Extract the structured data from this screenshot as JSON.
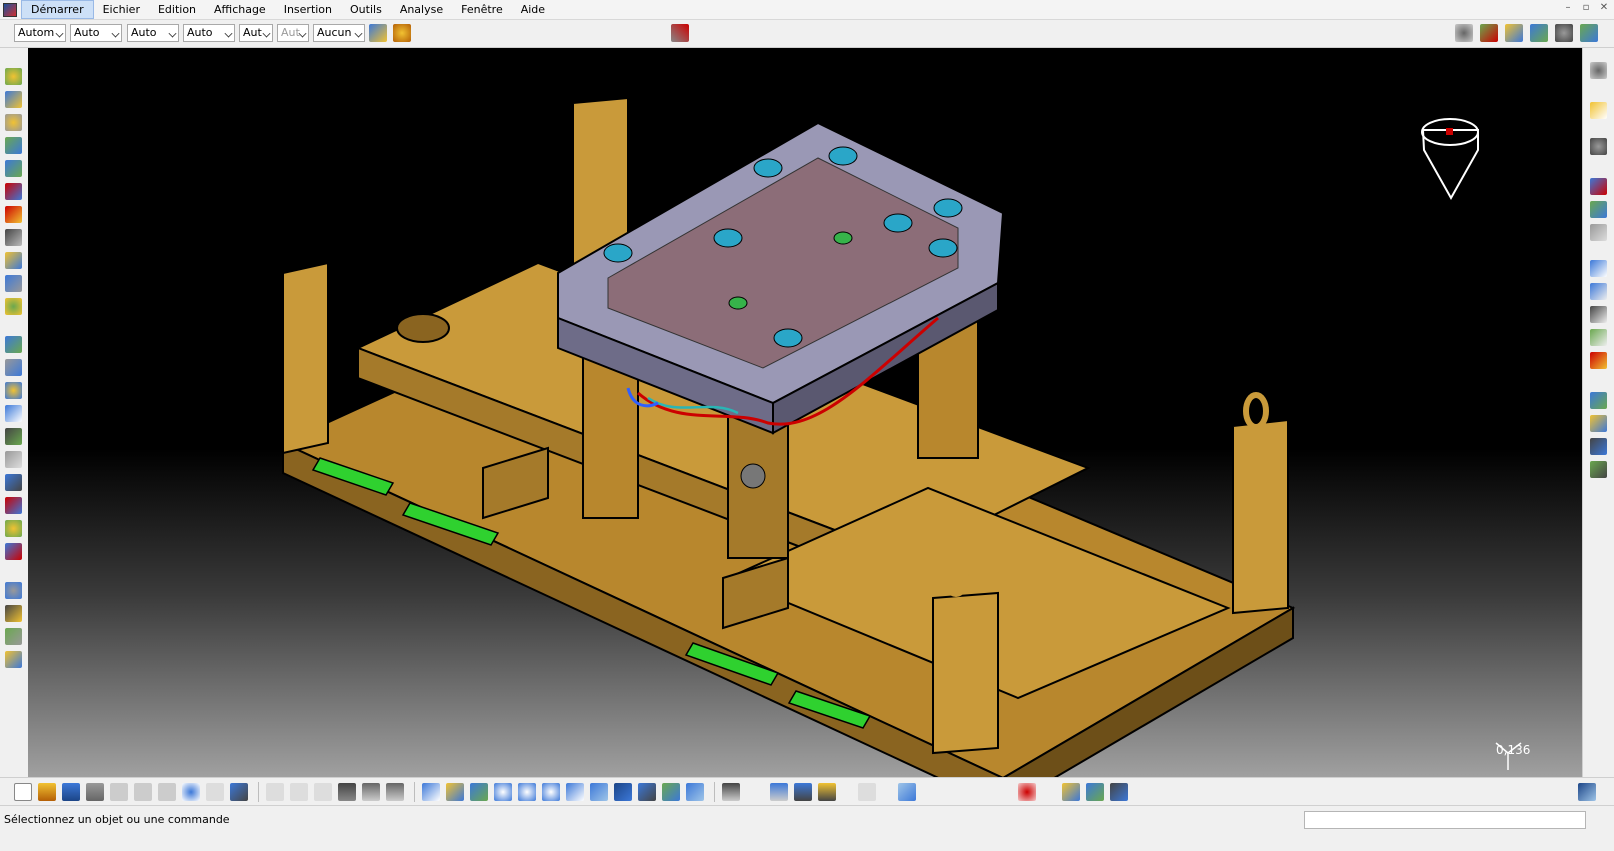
{
  "menubar": {
    "items": [
      {
        "label": "Démarrer",
        "active": true
      },
      {
        "label": "Eichier"
      },
      {
        "label": "Edition"
      },
      {
        "label": "Affichage"
      },
      {
        "label": "Insertion"
      },
      {
        "label": "Outils"
      },
      {
        "label": "Analyse"
      },
      {
        "label": "Fenêtre"
      },
      {
        "label": "Aide"
      }
    ],
    "window_controls": [
      "–",
      "▫",
      "✕"
    ]
  },
  "toolbar": {
    "combos": [
      {
        "value": "Autom"
      },
      {
        "value": "Auto"
      },
      {
        "value": "Auto"
      },
      {
        "value": "Auto"
      },
      {
        "value": "Aut"
      },
      {
        "value": "Aut",
        "disabled": true
      },
      {
        "value": "Aucun"
      }
    ]
  },
  "viewport": {
    "scale": "0,136",
    "colors": {
      "frame": "#c99a3a",
      "mold": "#8f8fa8",
      "pads": "#2fd12f"
    }
  },
  "status": {
    "message": "Sélectionnez un objet ou une commande"
  }
}
